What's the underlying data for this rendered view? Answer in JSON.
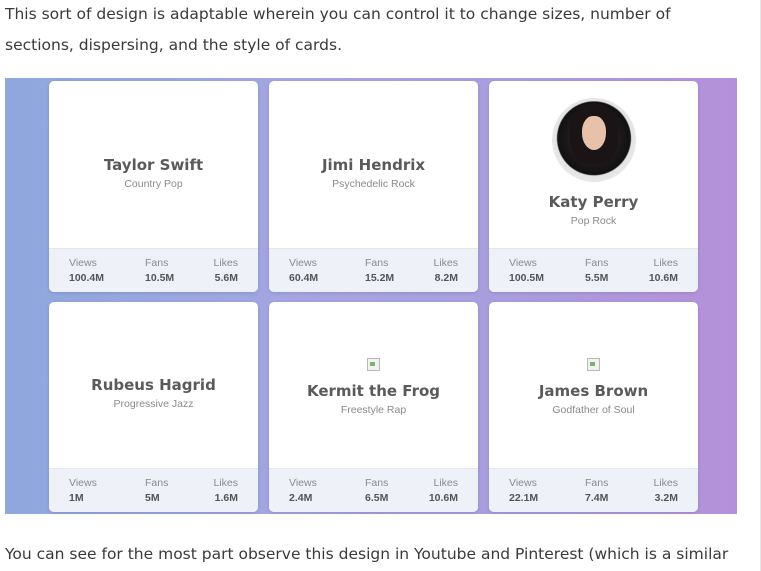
{
  "intro_text": "This sort of design is adaptable wherein you can control it to change sizes, number of sections, dispersing, and the style of cards.",
  "outro_text": "You can see for the most part observe this design in Youtube and Pinterest (which is a similar",
  "stat_labels": {
    "views": "Views",
    "fans": "Fans",
    "likes": "Likes"
  },
  "cards": [
    {
      "name": "Taylor Swift",
      "genre": "Country Pop",
      "views": "100.4M",
      "fans": "10.5M",
      "likes": "5.6M",
      "image": "none"
    },
    {
      "name": "Jimi Hendrix",
      "genre": "Psychedelic Rock",
      "views": "60.4M",
      "fans": "15.2M",
      "likes": "8.2M",
      "image": "none"
    },
    {
      "name": "Katy Perry",
      "genre": "Pop Rock",
      "views": "100.5M",
      "fans": "5.5M",
      "likes": "10.6M",
      "image": "avatar-photo"
    },
    {
      "name": "Rubeus Hagrid",
      "genre": "Progressive Jazz",
      "views": "1M",
      "fans": "5M",
      "likes": "1.6M",
      "image": "none"
    },
    {
      "name": "Kermit the Frog",
      "genre": "Freestyle Rap",
      "views": "2.4M",
      "fans": "6.5M",
      "likes": "10.6M",
      "image": "broken-image-icon"
    },
    {
      "name": "James Brown",
      "genre": "Godfather of Soul",
      "views": "22.1M",
      "fans": "7.4M",
      "likes": "3.2M",
      "image": "broken-image-icon"
    }
  ],
  "colors": {
    "gradient_start": "#8ea7dd",
    "gradient_end": "#b590d8",
    "stats_bg": "#eef1f8"
  }
}
